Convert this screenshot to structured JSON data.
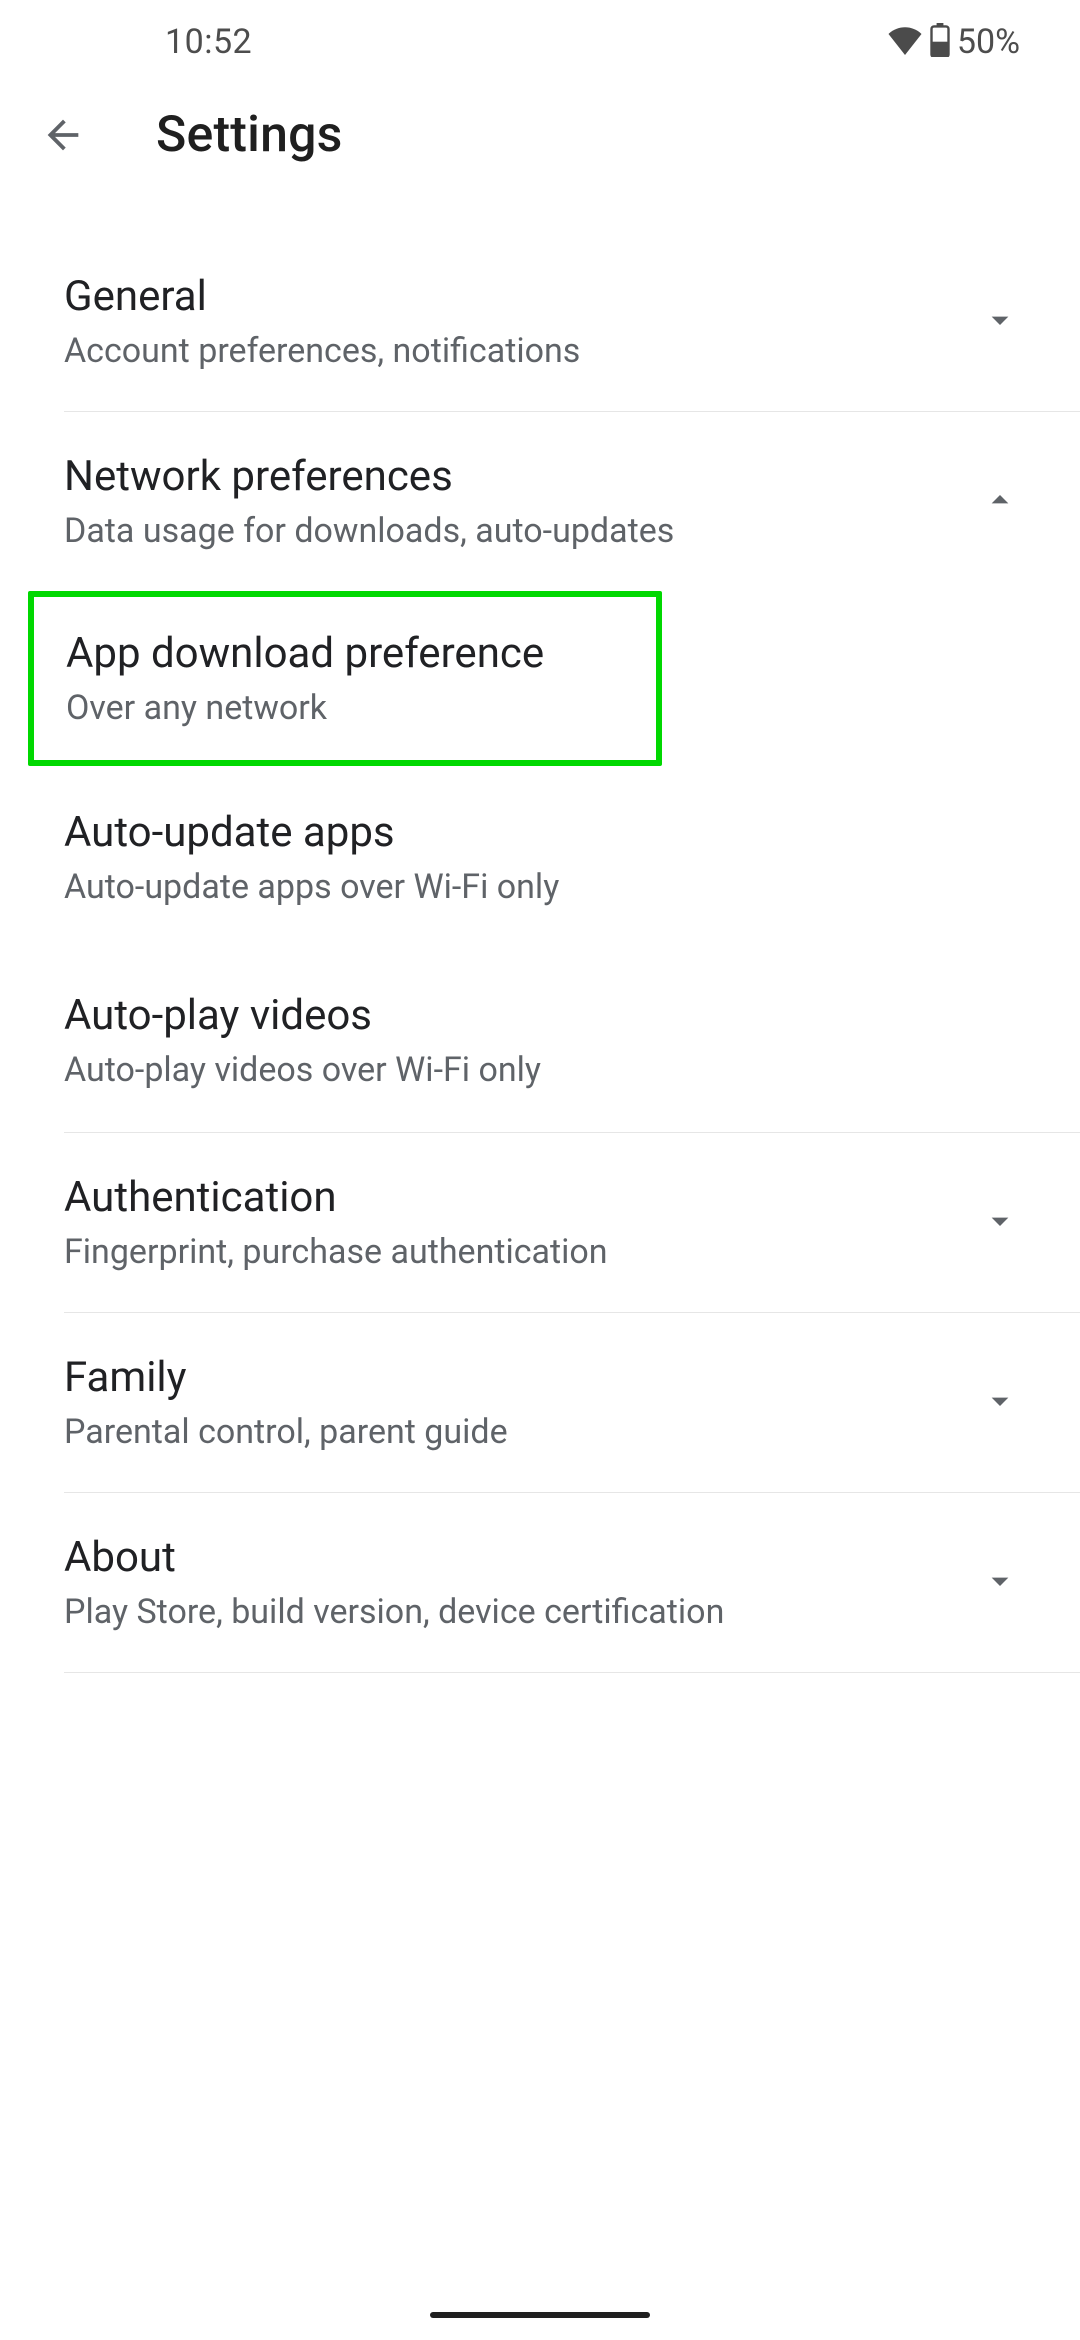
{
  "status": {
    "time": "10:52",
    "battery_pct": "50%"
  },
  "header": {
    "title": "Settings"
  },
  "sections": {
    "general": {
      "title": "General",
      "subtitle": "Account preferences, notifications",
      "expanded": false
    },
    "network": {
      "title": "Network preferences",
      "subtitle": "Data usage for downloads, auto-updates",
      "expanded": true,
      "items": {
        "app_download": {
          "title": "App download preference",
          "subtitle": "Over any network"
        },
        "auto_update": {
          "title": "Auto-update apps",
          "subtitle": "Auto-update apps over Wi-Fi only"
        },
        "auto_play": {
          "title": "Auto-play videos",
          "subtitle": "Auto-play videos over Wi-Fi only"
        }
      }
    },
    "auth": {
      "title": "Authentication",
      "subtitle": "Fingerprint, purchase authentication",
      "expanded": false
    },
    "family": {
      "title": "Family",
      "subtitle": "Parental control, parent guide",
      "expanded": false
    },
    "about": {
      "title": "About",
      "subtitle": "Play Store, build version, device certification",
      "expanded": false
    }
  },
  "highlight": "sections.network.items.app_download"
}
